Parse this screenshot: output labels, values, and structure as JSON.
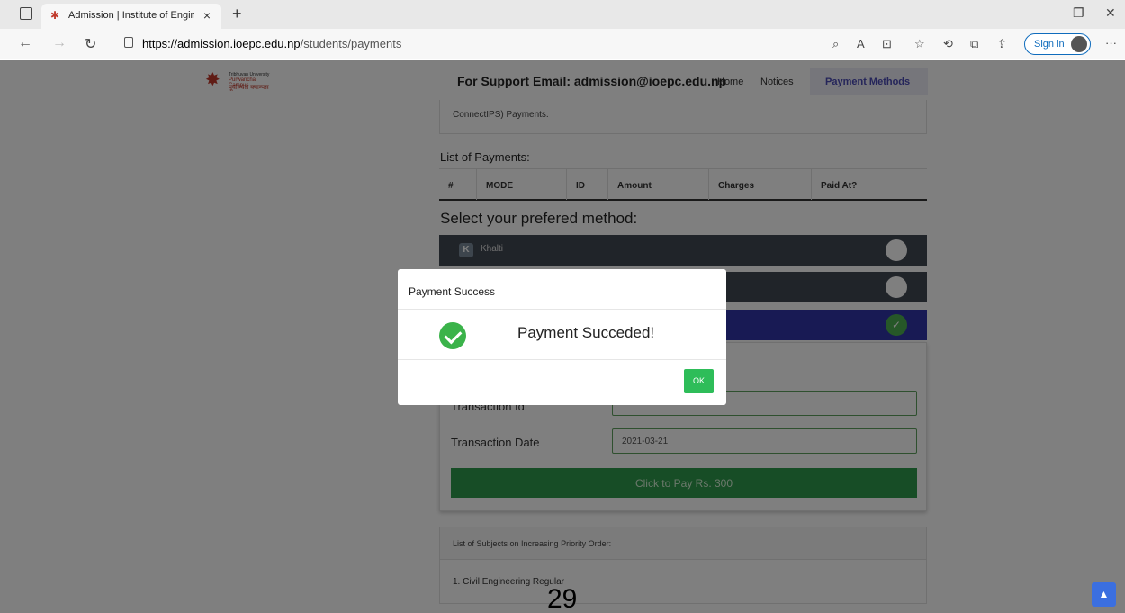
{
  "browser": {
    "tab_title": "Admission | Institute of Engineer",
    "tab_close": "×",
    "new_tab": "+",
    "url_host": "https://admission.ioepc.edu.np",
    "url_path": "/students/payments",
    "sign_in_label": "Sign in",
    "more_label": "···"
  },
  "site": {
    "logo_line1": "Tribhuvan University",
    "logo_line2": "Purwanchal Campus",
    "logo_line3": "पूर्वाञ्चल क्याम्पस",
    "support_text": "For Support Email: admission@ioepc.edu.np",
    "nav": [
      "Home",
      "Notices",
      "Payment Methods"
    ]
  },
  "notice": {
    "text": "ConnectIPS) Payments."
  },
  "payments": {
    "title": "List of Payments:",
    "columns": [
      "#",
      "MODE",
      "ID",
      "Amount",
      "Charges",
      "Paid At?"
    ]
  },
  "methods": {
    "title": "Select your prefered method:",
    "items": [
      {
        "label": "Khalti",
        "logo": "K"
      }
    ]
  },
  "form": {
    "transaction_id_label": "Transaction Id",
    "transaction_date_label": "Transaction Date",
    "transaction_date_value": "2021-03-21",
    "pay_button": "Click to Pay Rs. 300"
  },
  "subjects": {
    "title": "List of Subjects on Increasing Priority Order:",
    "items": [
      "1. Civil Engineering Regular"
    ]
  },
  "modal": {
    "title": "Payment Success",
    "message": "Payment Succeded!",
    "ok_label": "OK"
  },
  "page_number": "29",
  "colors": {
    "accent": "#3035a8",
    "success": "#2ebd59",
    "method_dark": "#414853"
  }
}
